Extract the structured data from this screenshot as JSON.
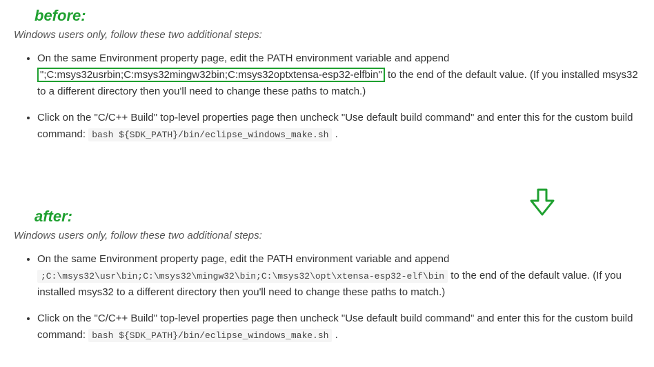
{
  "before": {
    "heading": "before:",
    "intro": "Windows users only, follow these two additional steps:",
    "bullet1_pre": "On the same Environment property page, edit the PATH environment variable and append ",
    "bullet1_boxed": "\";C:msys32usrbin;C:msys32mingw32bin;C:msys32optxtensa-esp32-elfbin\"",
    "bullet1_post": " to the end of the default value. (If you installed msys32 to a different directory then you'll need to change these paths to match.)",
    "bullet2_pre": "Click on the \"C/C++ Build\" top-level properties page then uncheck \"Use default build command\" and enter this for the custom build command: ",
    "bullet2_code": "bash ${SDK_PATH}/bin/eclipse_windows_make.sh",
    "bullet2_post": " ."
  },
  "after": {
    "heading": "after:",
    "intro": "Windows users only, follow these two additional steps:",
    "bullet1_pre": "On the same Environment property page, edit the PATH environment variable and append ",
    "bullet1_code": ";C:\\msys32\\usr\\bin;C:\\msys32\\mingw32\\bin;C:\\msys32\\opt\\xtensa-esp32-elf\\bin",
    "bullet1_post": " to the end of the default value. (If you installed msys32 to a different directory then you'll need to change these paths to match.)",
    "bullet2_pre": "Click on the \"C/C++ Build\" top-level properties page then uncheck \"Use default build command\" and enter this for the custom build command: ",
    "bullet2_code": "bash ${SDK_PATH}/bin/eclipse_windows_make.sh",
    "bullet2_post": " ."
  }
}
